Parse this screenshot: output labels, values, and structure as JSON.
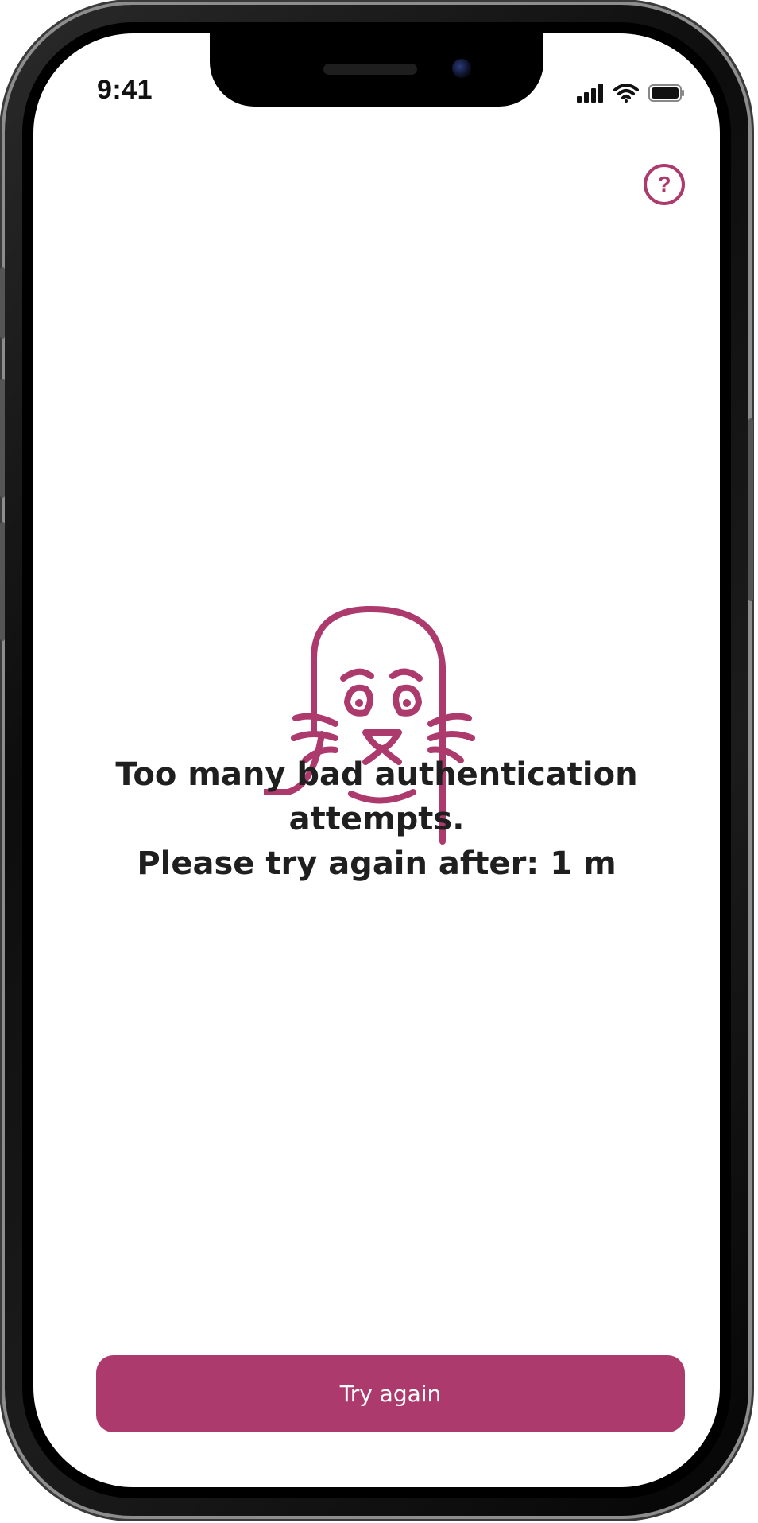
{
  "status_bar": {
    "time": "9:41",
    "icons": [
      "signal-icon",
      "wifi-icon",
      "battery-icon"
    ]
  },
  "header": {
    "help_icon": "help-circle-icon",
    "help_glyph": "?"
  },
  "illustration": {
    "icon": "sad-seal-icon"
  },
  "message": {
    "line1": "Too many bad authentication",
    "line2": "attempts.",
    "line3": "Please try again after: 1 m"
  },
  "actions": {
    "try_again_label": "Try again"
  },
  "colors": {
    "accent": "#ad3a6c",
    "text": "#1f1f1f",
    "background": "#ffffff"
  }
}
